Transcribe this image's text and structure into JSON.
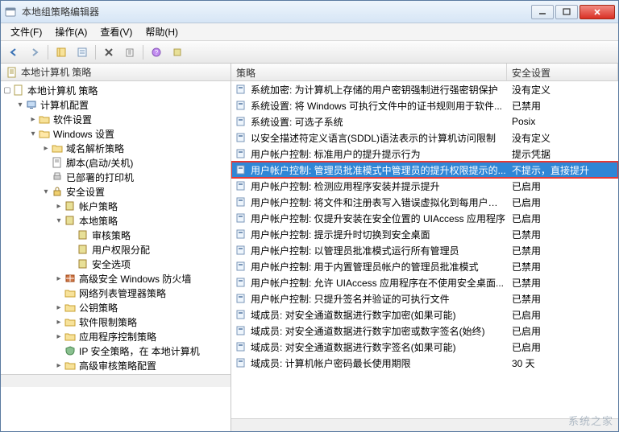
{
  "window": {
    "title": "本地组策略编辑器"
  },
  "menu": {
    "file": "文件(F)",
    "action": "操作(A)",
    "view": "查看(V)",
    "help": "帮助(H)"
  },
  "tree": {
    "header": "本地计算机 策略",
    "root": "本地计算机 策略",
    "n_computer": "计算机配置",
    "n_software": "软件设置",
    "n_windows": "Windows 设置",
    "n_dns": "域名解析策略",
    "n_scripts": "脚本(启动/关机)",
    "n_printers": "已部署的打印机",
    "n_security": "安全设置",
    "n_acctpol": "帐户策略",
    "n_localpol": "本地策略",
    "n_audit": "审核策略",
    "n_userrights": "用户权限分配",
    "n_secopts": "安全选项",
    "n_firewall": "高级安全 Windows 防火墙",
    "n_netlist": "网络列表管理器策略",
    "n_pubkey": "公钥策略",
    "n_softrestr": "软件限制策略",
    "n_appctrl": "应用程序控制策略",
    "n_ipsec": "IP 安全策略，在 本地计算机",
    "n_advaudit": "高级审核策略配置"
  },
  "list": {
    "col_policy": "策略",
    "col_setting": "安全设置",
    "rows": [
      {
        "name": "系统加密: 为计算机上存储的用户密钥强制进行强密钥保护",
        "value": "没有定义"
      },
      {
        "name": "系统设置: 将 Windows 可执行文件中的证书规则用于软件...",
        "value": "已禁用"
      },
      {
        "name": "系统设置: 可选子系统",
        "value": "Posix"
      },
      {
        "name": "以安全描述符定义语言(SDDL)语法表示的计算机访问限制",
        "value": "没有定义"
      },
      {
        "name": "用户帐户控制: 标准用户的提升提示行为",
        "value": "提示凭据"
      },
      {
        "name": "用户帐户控制: 管理员批准模式中管理员的提升权限提示的...",
        "value": "不提示，直接提升"
      },
      {
        "name": "用户帐户控制: 检测应用程序安装并提示提升",
        "value": "已启用"
      },
      {
        "name": "用户帐户控制: 将文件和注册表写入错误虚拟化到每用户位置",
        "value": "已启用"
      },
      {
        "name": "用户帐户控制: 仅提升安装在安全位置的 UIAccess 应用程序",
        "value": "已启用"
      },
      {
        "name": "用户帐户控制: 提示提升时切换到安全桌面",
        "value": "已禁用"
      },
      {
        "name": "用户帐户控制: 以管理员批准模式运行所有管理员",
        "value": "已禁用"
      },
      {
        "name": "用户帐户控制: 用于内置管理员帐户的管理员批准模式",
        "value": "已禁用"
      },
      {
        "name": "用户帐户控制: 允许 UIAccess 应用程序在不使用安全桌面...",
        "value": "已禁用"
      },
      {
        "name": "用户帐户控制: 只提升签名并验证的可执行文件",
        "value": "已禁用"
      },
      {
        "name": "域成员: 对安全通道数据进行数字加密(如果可能)",
        "value": "已启用"
      },
      {
        "name": "域成员: 对安全通道数据进行数字加密或数字签名(始终)",
        "value": "已启用"
      },
      {
        "name": "域成员: 对安全通道数据进行数字签名(如果可能)",
        "value": "已启用"
      },
      {
        "name": "域成员: 计算机帐户密码最长使用期限",
        "value": "30 天"
      }
    ],
    "highlight": 5
  },
  "watermark": "系统之家"
}
